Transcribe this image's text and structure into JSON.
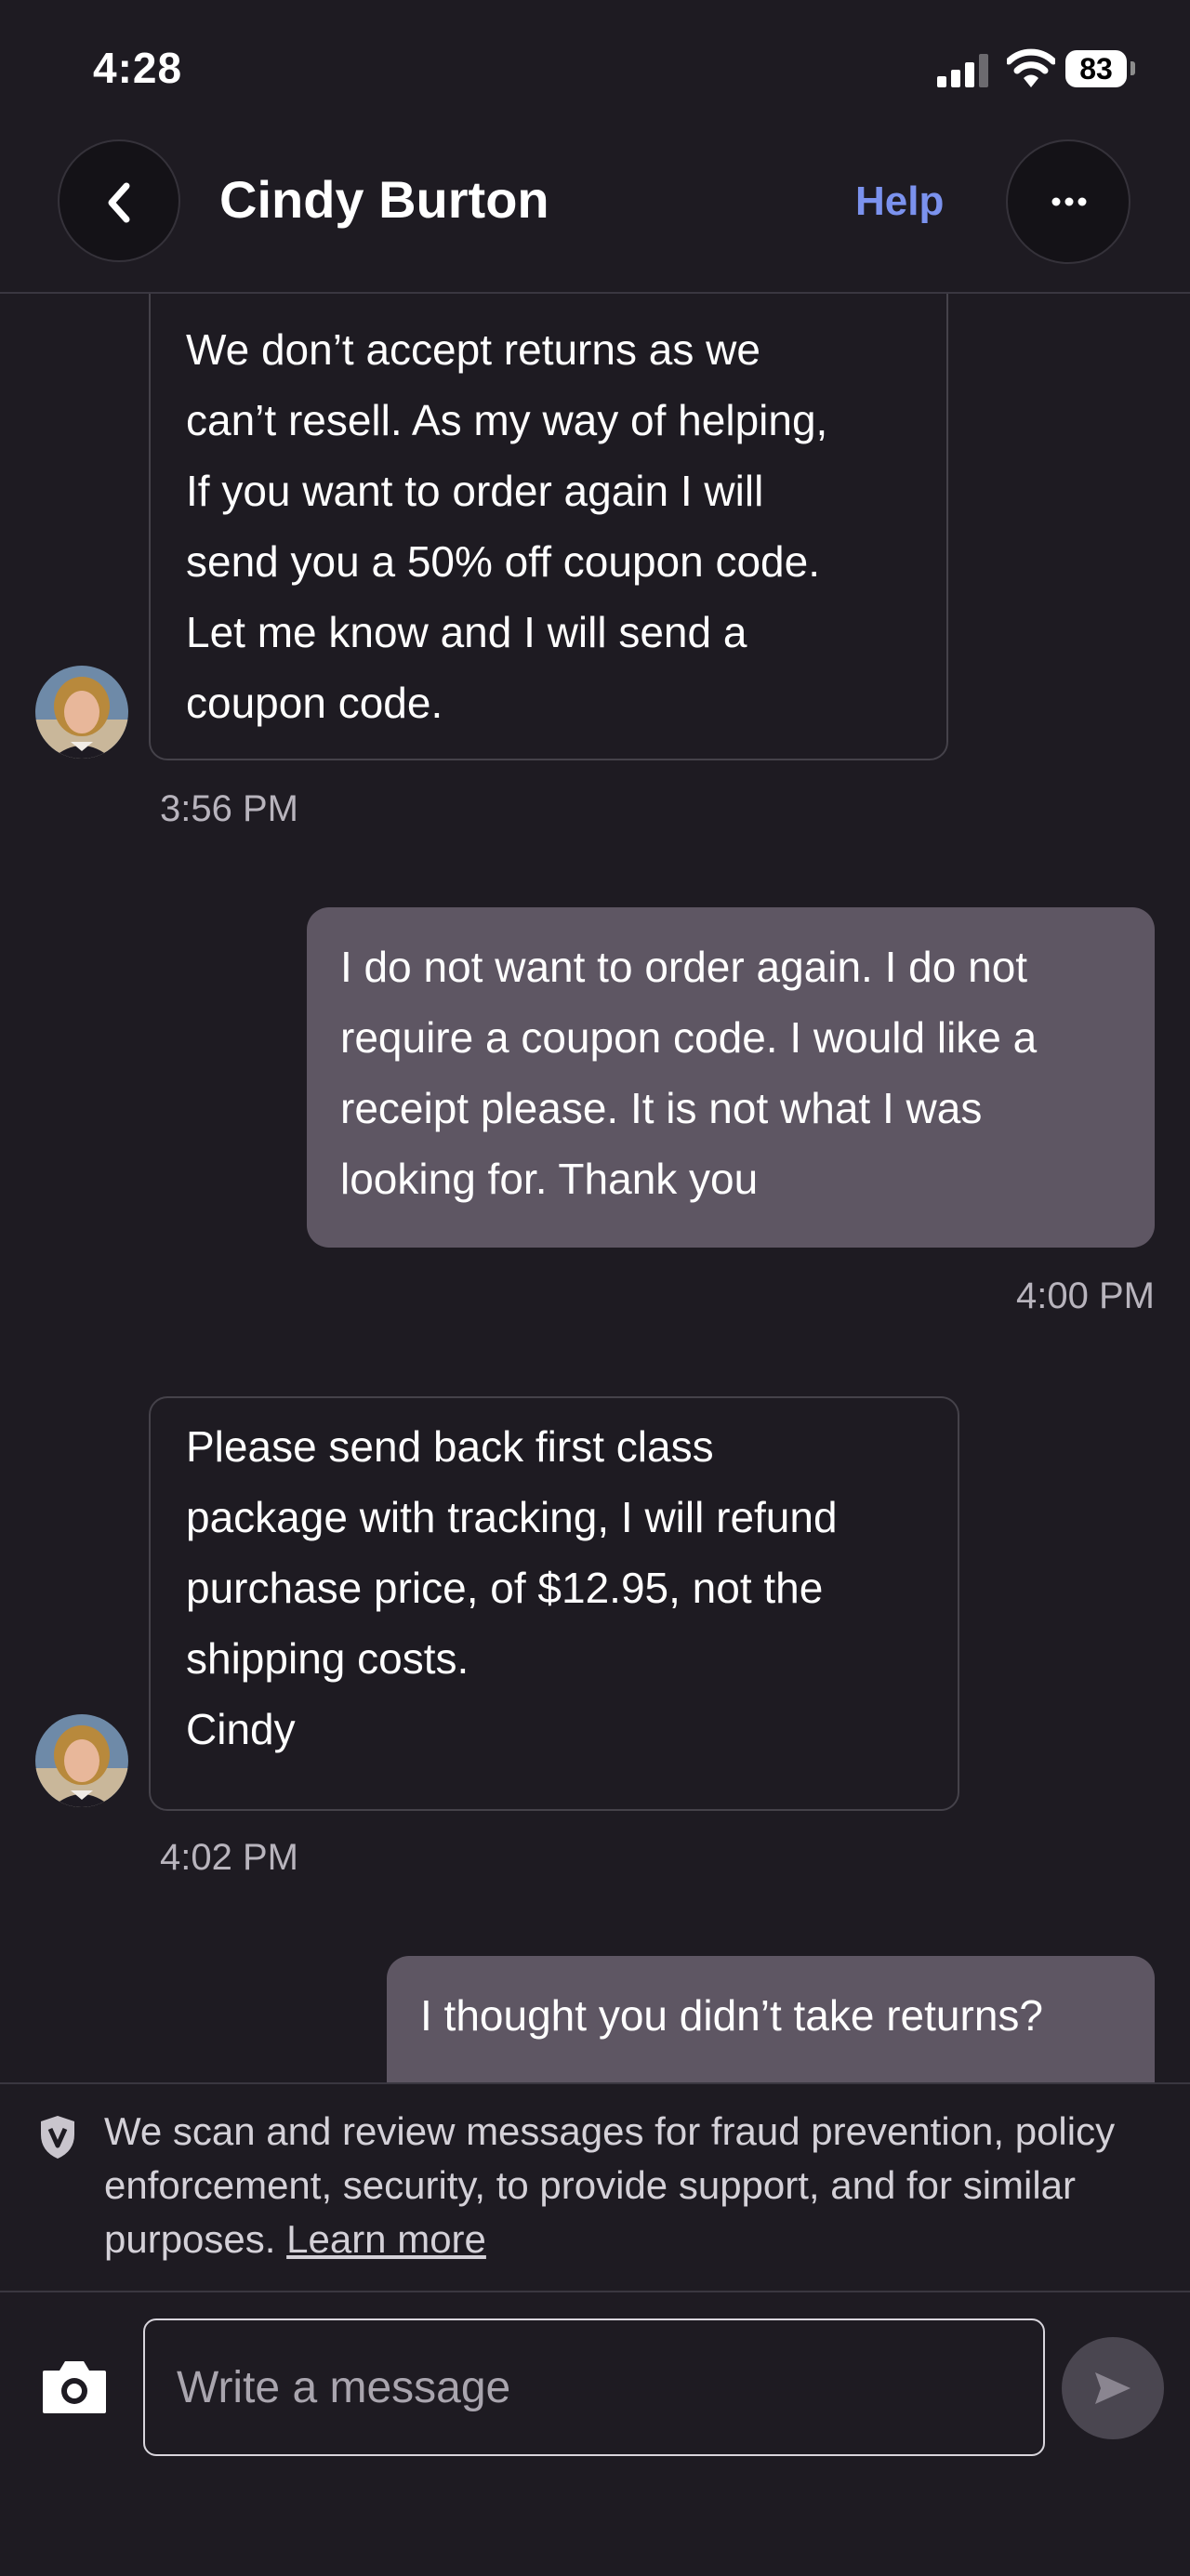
{
  "status_bar": {
    "time": "4:28",
    "battery": "83"
  },
  "header": {
    "contact_name": "Cindy Burton",
    "help_label": "Help"
  },
  "messages": [
    {
      "direction": "in",
      "text": "We don’t accept returns as we\ncan’t  resell. As my way of helping,\nIf you want to order again I will\nsend you a 50% off coupon code.\nLet me know and I will send a\ncoupon code.",
      "time": "3:56 PM"
    },
    {
      "direction": "out",
      "text": "I do not want to order again. I do not\nrequire a coupon code. I would like a\nreceipt please. It is not what I was\nlooking for. Thank you",
      "time": "4:00 PM"
    },
    {
      "direction": "in",
      "text": "Please send back first class\npackage with tracking, I will refund\npurchase price, of $12.95, not the\nshipping costs.\nCindy",
      "time": "4:02 PM"
    },
    {
      "direction": "out",
      "text": "I thought you didn’t take returns?",
      "time": ""
    }
  ],
  "notice": {
    "text": "We scan and review messages for fraud prevention, policy enforcement, security, to provide support, and for similar purposes. ",
    "link_label": "Learn more"
  },
  "composer": {
    "placeholder": "Write a message"
  },
  "colors": {
    "background": "#1e1b22",
    "outgoing_bubble": "#5e5663",
    "accent": "#7b92ee"
  },
  "icons": [
    "back-arrow-icon",
    "more-icon",
    "shield-v-icon",
    "camera-icon",
    "send-icon"
  ]
}
